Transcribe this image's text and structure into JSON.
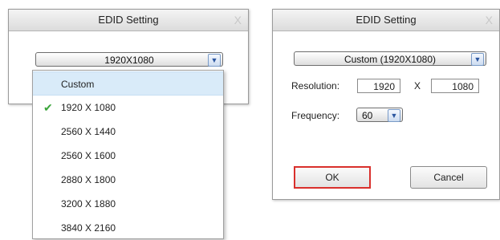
{
  "left_dialog": {
    "title": "EDID Setting",
    "close_glyph": "X",
    "combo_value": "1920X1080",
    "options": [
      {
        "label": "Custom",
        "highlighted": true,
        "checked": false
      },
      {
        "label": "1920 X 1080",
        "highlighted": false,
        "checked": true
      },
      {
        "label": "2560 X 1440",
        "highlighted": false,
        "checked": false
      },
      {
        "label": "2560 X 1600",
        "highlighted": false,
        "checked": false
      },
      {
        "label": "2880 X 1800",
        "highlighted": false,
        "checked": false
      },
      {
        "label": "3200 X 1880",
        "highlighted": false,
        "checked": false
      },
      {
        "label": "3840 X 2160",
        "highlighted": false,
        "checked": false
      }
    ]
  },
  "right_dialog": {
    "title": "EDID Setting",
    "close_glyph": "X",
    "combo_value": "Custom (1920X1080)",
    "resolution_label": "Resolution:",
    "width_value": "1920",
    "x_separator": "X",
    "height_value": "1080",
    "frequency_label": "Frequency:",
    "frequency_value": "60",
    "ok_label": "OK",
    "cancel_label": "Cancel"
  },
  "icons": {
    "check": "check-icon",
    "dropdown_arrow": "chevron-down-icon",
    "close": "close-icon"
  },
  "colors": {
    "ok_highlight_border": "#d9302c",
    "check_color": "#3aa53a",
    "menu_highlight": "#d9ebf9"
  }
}
